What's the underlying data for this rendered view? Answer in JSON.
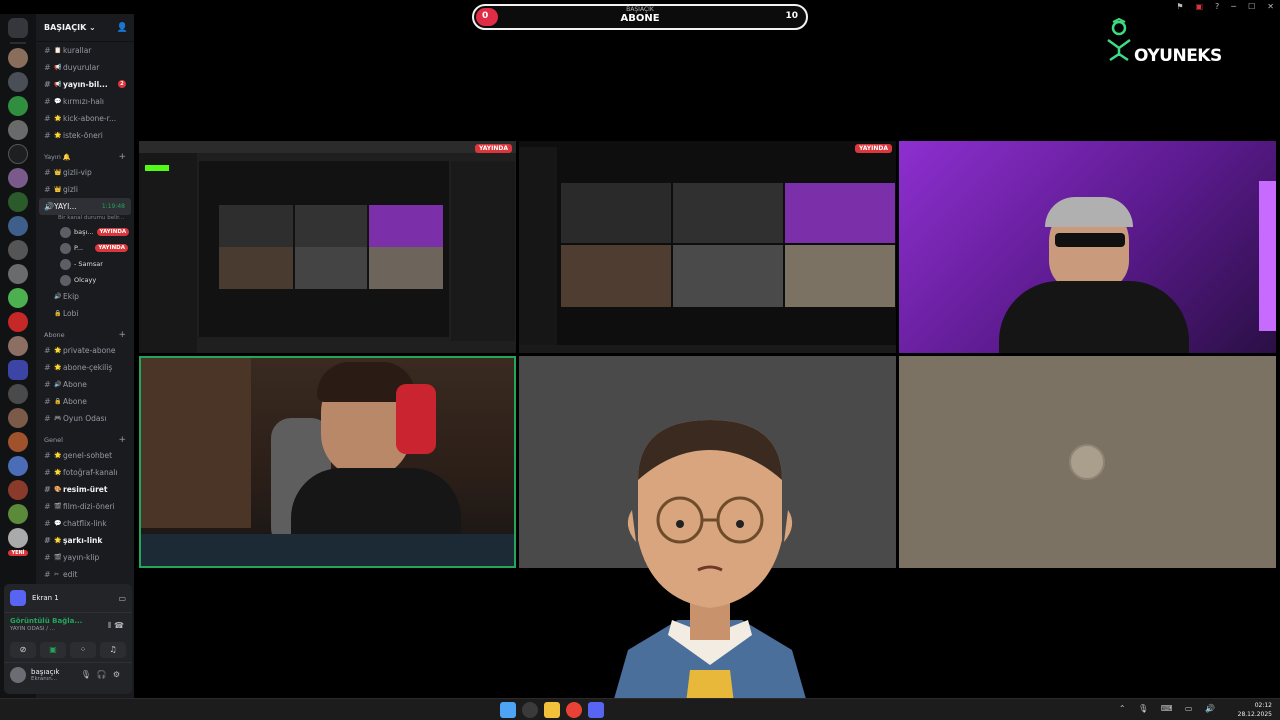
{
  "window_controls": [
    "flag-icon",
    "screen-icon",
    "help-icon",
    "minimize-icon",
    "maximize-icon",
    "close-icon"
  ],
  "subscriber_goal": {
    "owner": "BAŞIAÇIK",
    "label": "ABONE",
    "current": "0",
    "goal": "10",
    "progress_fraction": 0.0
  },
  "logo": {
    "text": "OYUNEKS"
  },
  "server_rail": {
    "new_badge": "YENİ"
  },
  "sidebar": {
    "server_name": "BAŞIAÇIK",
    "channels_top": [
      {
        "name": "kurallar",
        "emoji": "📋",
        "bold": false
      },
      {
        "name": "duyurular",
        "emoji": "📢",
        "bold": false
      },
      {
        "name": "yayın-bil...",
        "emoji": "📢",
        "bold": true,
        "badge": "2"
      },
      {
        "name": "kırmızı-halı",
        "emoji": "💬",
        "bold": false
      },
      {
        "name": "kick-abone-r...",
        "emoji": "🌟",
        "bold": false
      },
      {
        "name": "istek-öneri",
        "emoji": "🌟",
        "bold": false
      }
    ],
    "cat_yayin": "Yayın 🔔",
    "channels_yayin": [
      {
        "name": "gizli-vip",
        "emoji": "👑"
      },
      {
        "name": "gizli",
        "emoji": "👑"
      }
    ],
    "voice_active": {
      "name": "YAYI...",
      "timer": "1:19:48",
      "subtitle": "Bir kanal durumu belir..."
    },
    "voice_users": [
      {
        "name": "başı...",
        "live": "YAYINDA"
      },
      {
        "name": "P...",
        "live": "YAYINDA"
      },
      {
        "name": "- Samsar",
        "live": ""
      },
      {
        "name": "Olcayy",
        "live": ""
      }
    ],
    "channels_voice": [
      {
        "name": "Ekip",
        "emoji": "🔊"
      },
      {
        "name": "Lobi",
        "emoji": "🔒"
      }
    ],
    "cat_abone": "Abone",
    "channels_abone": [
      {
        "name": "private-abone",
        "emoji": "🌟"
      },
      {
        "name": "abone-çekiliş",
        "emoji": "🌟"
      },
      {
        "name": "Abone",
        "emoji": "🔊"
      },
      {
        "name": "Abone",
        "emoji": "🔒"
      },
      {
        "name": "Oyun Odası",
        "emoji": "🎮"
      }
    ],
    "cat_genel": "Genel",
    "channels_genel": [
      {
        "name": "genel-sohbet",
        "emoji": "🌟",
        "bold": false
      },
      {
        "name": "fotoğraf-kanalı",
        "emoji": "🌟",
        "bold": false
      },
      {
        "name": "resim-üret",
        "emoji": "🎨",
        "bold": true
      },
      {
        "name": "film-dizi-öneri",
        "emoji": "🎬",
        "bold": false
      },
      {
        "name": "chatflix-link",
        "emoji": "💬",
        "bold": false
      },
      {
        "name": "şarkı-link",
        "emoji": "🌟",
        "bold": true
      },
      {
        "name": "yayın-klip",
        "emoji": "🎬",
        "bold": false
      },
      {
        "name": "edit",
        "emoji": "✂",
        "bold": false
      }
    ]
  },
  "voice_panel": {
    "screen_label": "Ekran 1",
    "connection_status": "Görüntülü Bağla...",
    "connection_channel": "YAYIN ODASI / ...",
    "user_name": "başıaçık",
    "user_status": "Ekranın..."
  },
  "tiles": {
    "live_tag": "YAYINDA"
  },
  "taskbar": {
    "time": "02:12",
    "date": "28.12.2025"
  }
}
